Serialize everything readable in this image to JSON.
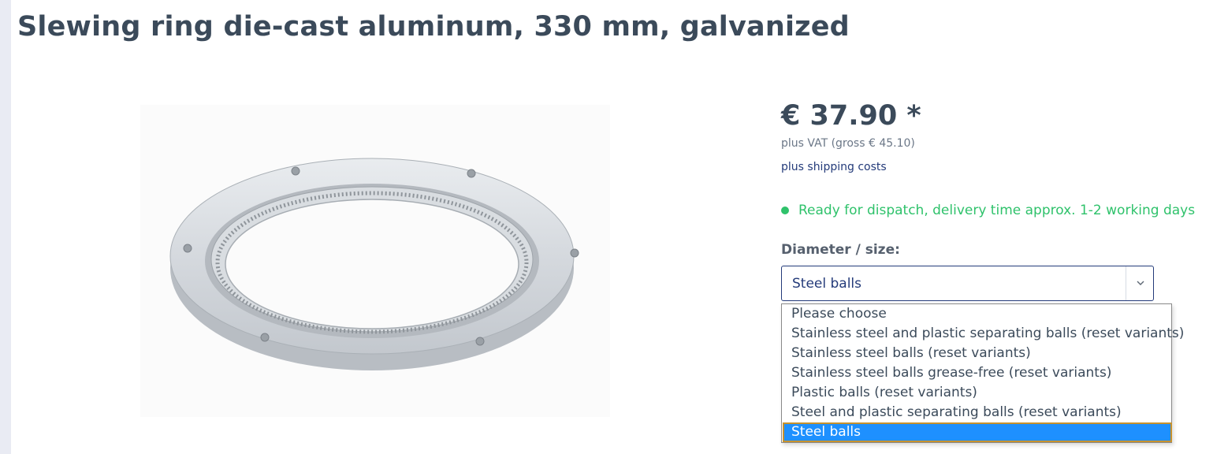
{
  "product": {
    "title": "Slewing ring die-cast aluminum, 330 mm, galvanized",
    "price": "€ 37.90 *",
    "vat_note": "plus VAT (gross € 45.10)",
    "shipping_link": "plus shipping costs",
    "availability": "Ready for dispatch, delivery time approx. 1-2 working days",
    "image_icon": "slewing-ring-photo"
  },
  "variant": {
    "label": "Diameter / size:",
    "selected": "Steel balls",
    "options": [
      "Please choose",
      "Stainless steel and plastic separating balls (reset variants)",
      "Stainless steel balls (reset variants)",
      "Stainless steel balls grease-free (reset variants)",
      "Plastic balls (reset variants)",
      "Steel and plastic separating balls (reset variants)",
      "Steel balls"
    ]
  },
  "colors": {
    "text": "#3b4a5a",
    "link": "#243b7a",
    "available": "#2fc26b",
    "highlight": "#1e90ff"
  }
}
